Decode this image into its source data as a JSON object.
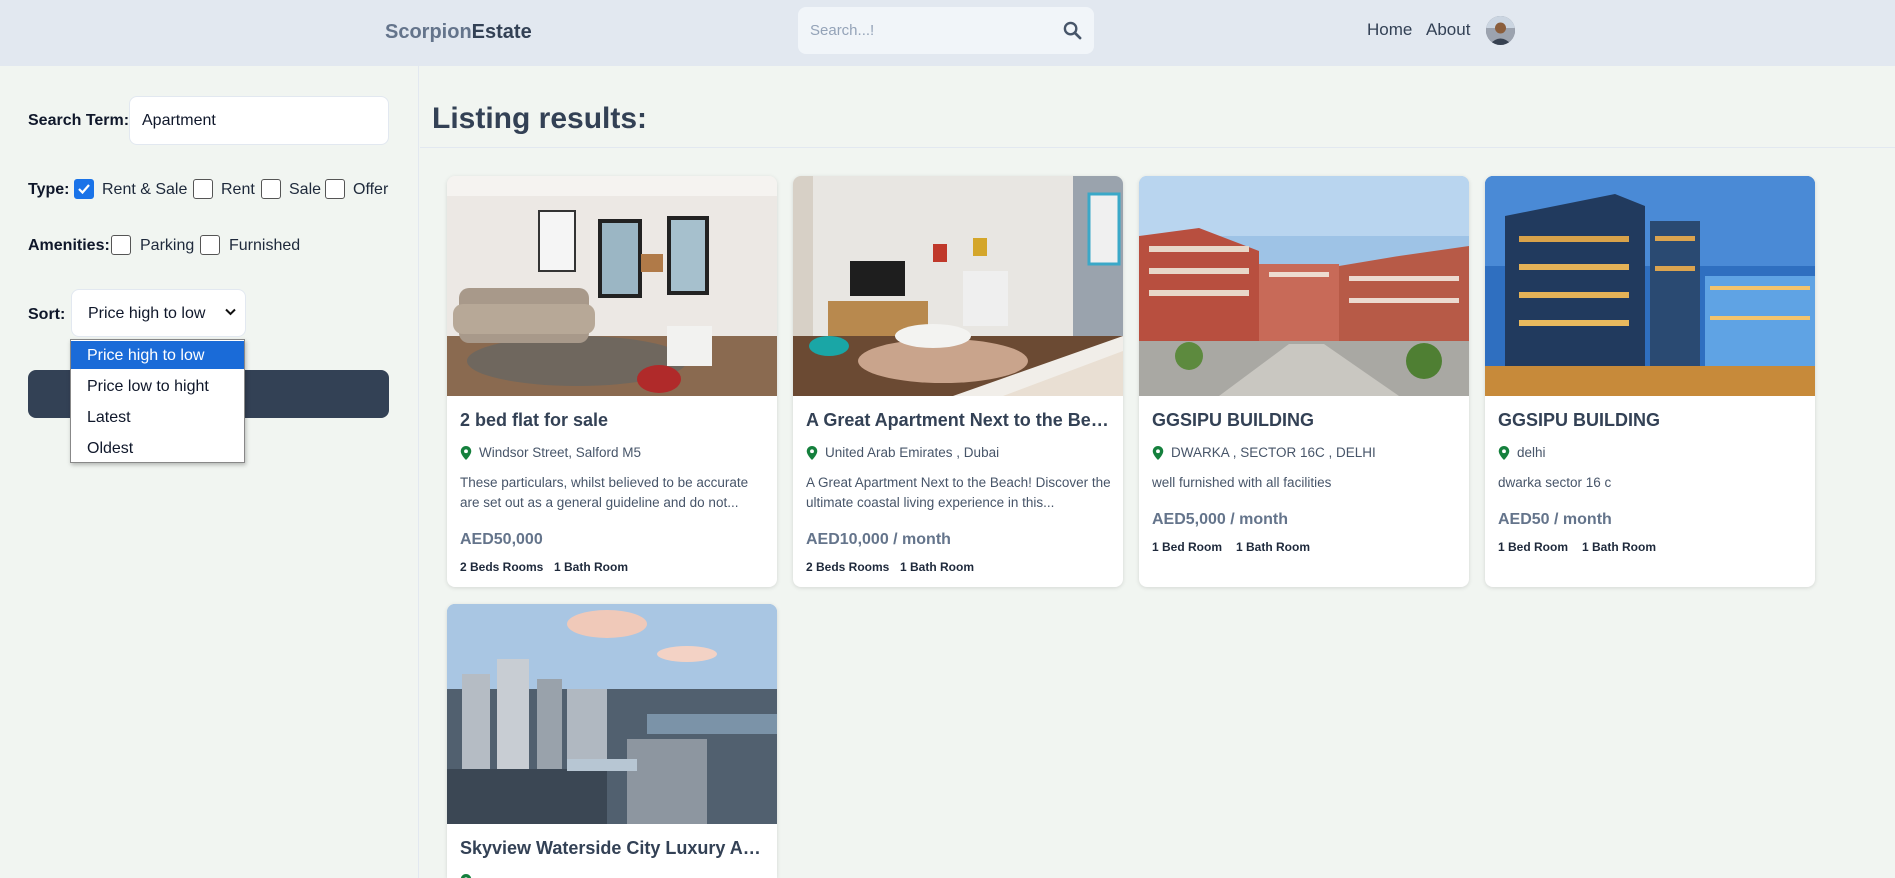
{
  "header": {
    "logo_part1": "Scorpion",
    "logo_part2": "Estate",
    "search_placeholder": "Search...!",
    "nav_home": "Home",
    "nav_about": "About"
  },
  "sidebar": {
    "search_term_label": "Search Term:",
    "search_term_value": "Apartment",
    "type_label": "Type:",
    "type_options": [
      {
        "label": "Rent & Sale",
        "checked": true
      },
      {
        "label": "Rent",
        "checked": false
      },
      {
        "label": "Sale",
        "checked": false
      },
      {
        "label": "Offer",
        "checked": false
      }
    ],
    "amenities_label": "Amenities:",
    "amenities_options": [
      {
        "label": "Parking",
        "checked": false
      },
      {
        "label": "Furnished",
        "checked": false
      }
    ],
    "sort_label": "Sort:",
    "sort_selected": "Price high to low",
    "sort_options": [
      "Price high to low",
      "Price low to hight",
      "Latest",
      "Oldest"
    ]
  },
  "main": {
    "title": "Listing results:",
    "listings": [
      {
        "name": "2 bed flat for sale",
        "location": "Windsor Street, Salford M5",
        "description": "These particulars, whilst believed to be accurate are set out as a general guideline and do not...",
        "price": "AED50,000",
        "beds": "2 Beds Rooms",
        "baths": "1 Bath Room"
      },
      {
        "name": "A Great Apartment Next to the Bea...",
        "location": "United Arab Emirates , Dubai",
        "description": "A Great Apartment Next to the Beach! Discover the ultimate coastal living experience in this...",
        "price": "AED10,000 / month",
        "beds": "2 Beds Rooms",
        "baths": "1 Bath Room"
      },
      {
        "name": "GGSIPU BUILDING",
        "location": "DWARKA , SECTOR 16C , DELHI",
        "description": "well furnished with all facilities",
        "price": "AED5,000 / month",
        "beds": "1 Bed Room",
        "baths": "1 Bath Room"
      },
      {
        "name": "GGSIPU BUILDING",
        "location": "delhi",
        "description": "dwarka sector 16 c",
        "price": "AED50 / month",
        "beds": "1 Bed Room",
        "baths": "1 Bath Room"
      },
      {
        "name": "Skyview Waterside City Luxury Apa...",
        "location": "",
        "description": "",
        "price": "",
        "beds": "",
        "baths": ""
      }
    ]
  },
  "colors": {
    "header_bg": "#e2e8f0",
    "page_bg": "#f1f5f1",
    "primary_dark": "#334155",
    "checkbox_blue": "#1a73e8",
    "pin_green": "#15803d"
  }
}
